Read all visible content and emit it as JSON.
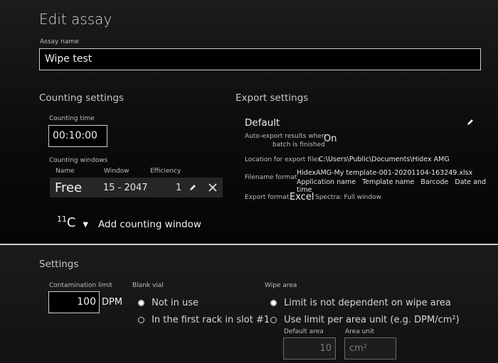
{
  "page": {
    "title": "Edit assay"
  },
  "assay": {
    "label": "Assay name",
    "value": "Wipe test"
  },
  "counting": {
    "section": "Counting settings",
    "time_label": "Counting time",
    "time_value": "00:10:00",
    "windows_label": "Counting windows",
    "headers": [
      "Name",
      "Window",
      "Efficiency"
    ],
    "row": {
      "name": "Free",
      "window": "15 - 2047",
      "efficiency": "1"
    },
    "isotope_mass": "11",
    "isotope_symbol": "C",
    "add_window": "Add counting window"
  },
  "export": {
    "section": "Export settings",
    "default_name": "Default",
    "auto_export_line1": "Auto-export results when",
    "auto_export_line2": "batch is finished",
    "auto_export_value": "On",
    "location_label": "Location for export files",
    "location_value": "C:\\Users\\Public\\Documents\\Hidex AMG",
    "filename_label": "Filename format",
    "filename_value": "HidexAMG-My template-001-20201104-163249.xlsx",
    "filename_parts": [
      "Application name",
      "Template name",
      "Barcode",
      "Date and time"
    ],
    "format_label": "Export format",
    "format_value": "Excel",
    "spectra": "Spectra: Full window"
  },
  "settings": {
    "section": "Settings",
    "contamination_label": "Contamination limit",
    "contamination_value": "100",
    "contamination_unit": "DPM",
    "blank_label": "Blank vial",
    "blank_opt1": "Not in use",
    "blank_opt2": "In the first rack in slot #1",
    "wipe_label": "Wipe area",
    "wipe_opt1": "Limit is not dependent on wipe area",
    "wipe_opt2": "Use limit per area unit (e.g. DPM/cm²)",
    "default_area_label": "Default area",
    "default_area_value": "10",
    "area_unit_label": "Area unit",
    "area_unit_value": "cm²"
  }
}
